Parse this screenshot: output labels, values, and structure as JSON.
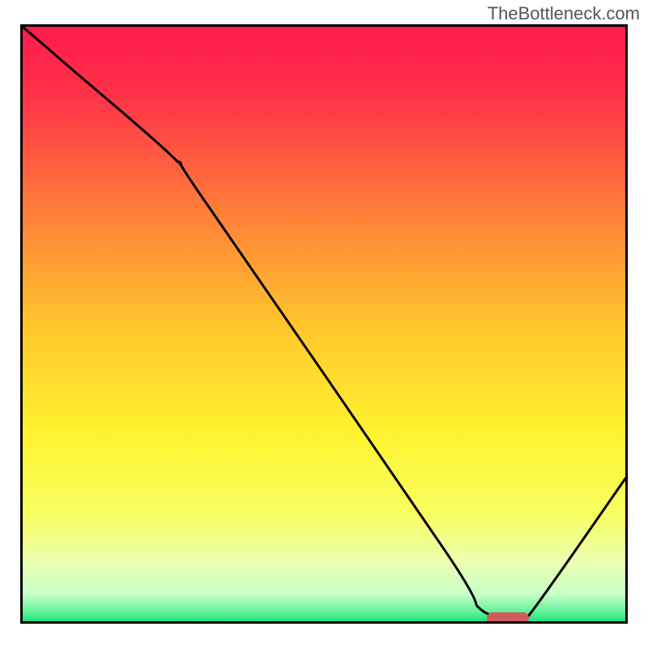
{
  "attribution": "TheBottleneck.com",
  "chart_data": {
    "type": "line",
    "title": "",
    "xlabel": "",
    "ylabel": "",
    "xlim": [
      0,
      100
    ],
    "ylim": [
      0,
      100
    ],
    "grid": false,
    "legend": "none",
    "series": [
      {
        "name": "bottleneck-curve",
        "x": [
          0,
          8,
          25,
          30,
          70,
          76,
          82,
          84,
          100
        ],
        "values": [
          100,
          93,
          78,
          71,
          12,
          2,
          1,
          1,
          24
        ]
      }
    ],
    "marker": {
      "name": "optimal-zone",
      "x_start": 77,
      "x_end": 84,
      "y": 0.5,
      "color": "#d15a5a"
    },
    "background_gradient": {
      "stops": [
        {
          "pos": 0.0,
          "color": "#ff1a4d"
        },
        {
          "pos": 0.12,
          "color": "#ff3348"
        },
        {
          "pos": 0.3,
          "color": "#ff7a3a"
        },
        {
          "pos": 0.5,
          "color": "#ffc52c"
        },
        {
          "pos": 0.68,
          "color": "#fff22e"
        },
        {
          "pos": 0.82,
          "color": "#f7ff60"
        },
        {
          "pos": 0.9,
          "color": "#eaffb0"
        },
        {
          "pos": 0.955,
          "color": "#c8ffc8"
        },
        {
          "pos": 0.985,
          "color": "#5ef098"
        },
        {
          "pos": 1.0,
          "color": "#1fe07a"
        }
      ]
    }
  }
}
